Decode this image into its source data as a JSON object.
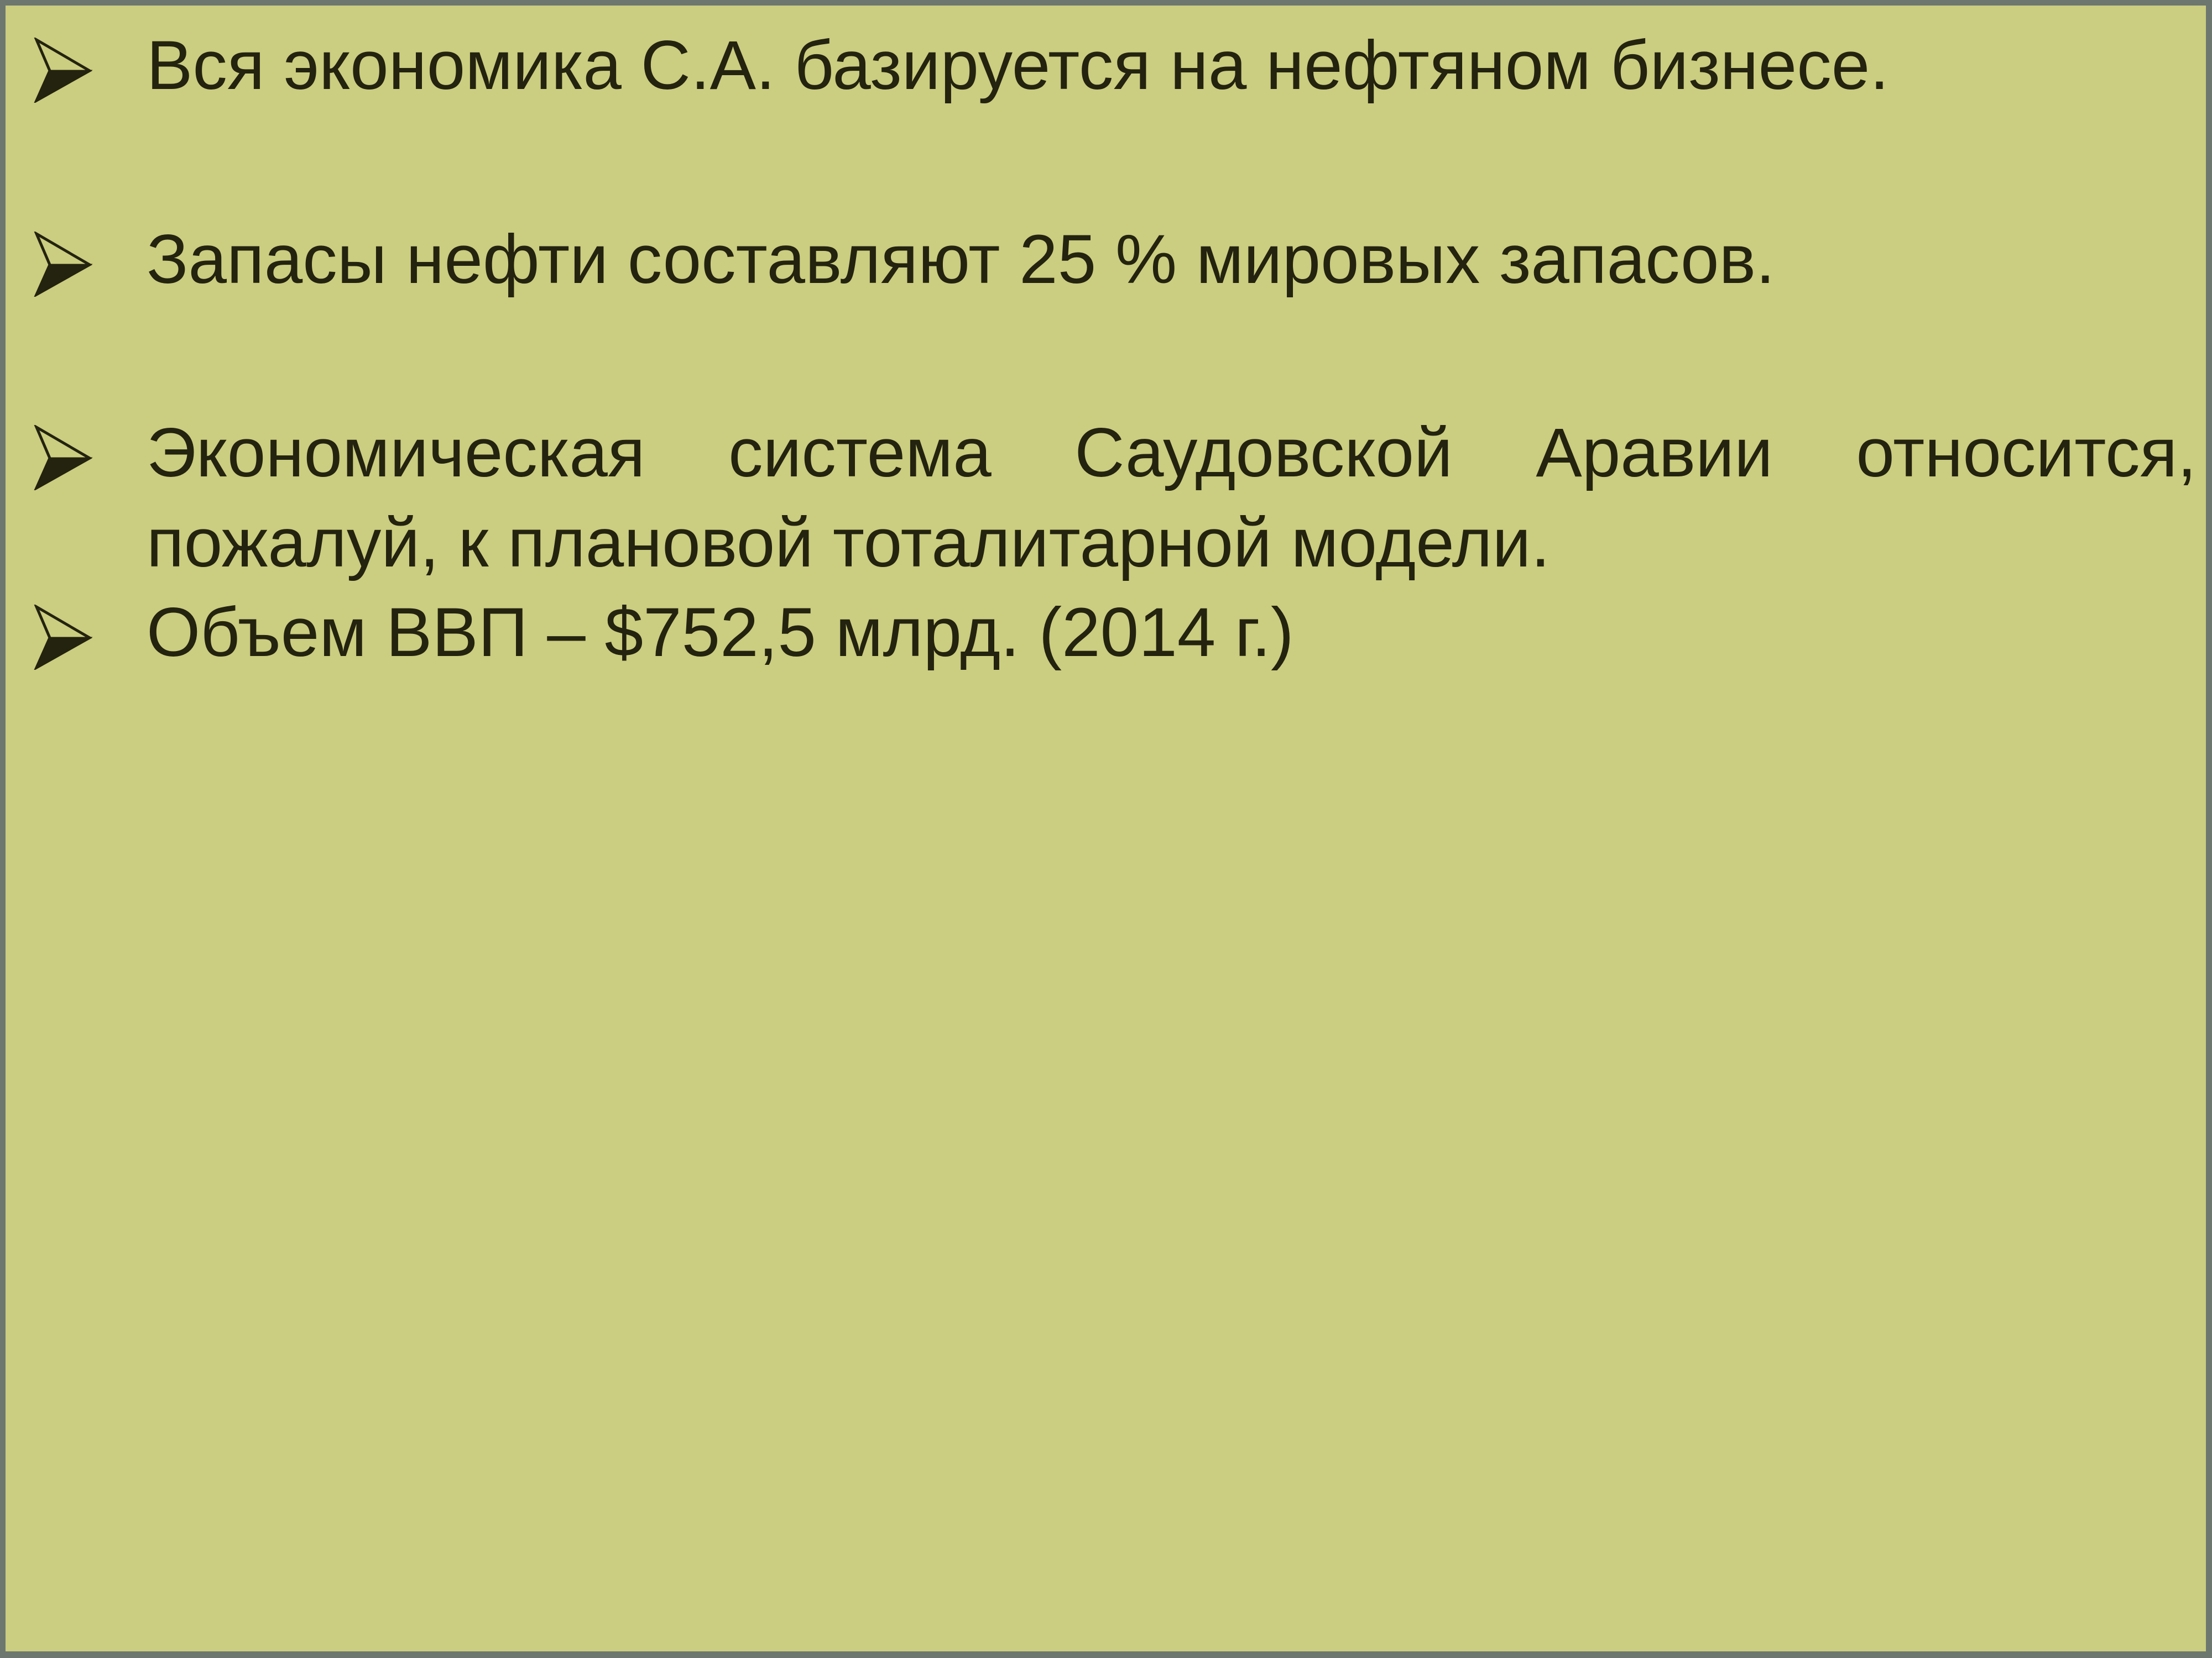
{
  "slide": {
    "background_color": "#cbcd80",
    "border_color": "#6d776f",
    "text_color": "#23230f",
    "bullet_glyph": "arrowhead-bullet"
  },
  "bullets": [
    {
      "id": "bullet-1",
      "text": "Вся экономика С.А. базируется на нефтяном бизнесе.",
      "justified": true
    },
    {
      "id": "bullet-2",
      "text": "Запасы нефти составляют 25 % мировых запасов.",
      "justified": false
    },
    {
      "id": "bullet-3",
      "text": "Экономическая система Саудовской Аравии относится, пожалуй, к плановой тоталитарной модели.",
      "justified": true
    },
    {
      "id": "bullet-4",
      "text": "Объем ВВП – $752,5 млрд. (2014 г.)",
      "justified": false
    }
  ]
}
